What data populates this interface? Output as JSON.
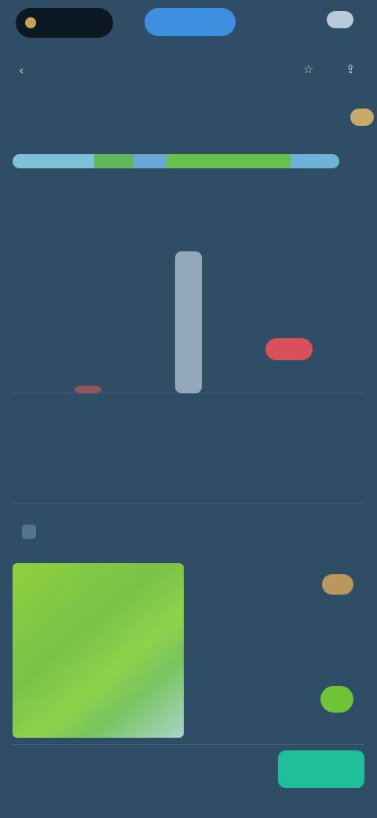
{
  "topbar": {
    "brand": "",
    "primary_action": "",
    "right_text": ""
  },
  "titlebar": {
    "back_icon": "chevron-left-icon",
    "title": "",
    "meta": "",
    "star_icon": "star-icon",
    "share_icon": "share-icon"
  },
  "tabs": [
    {
      "label": "",
      "value": ""
    },
    {
      "label": "",
      "value": ""
    },
    {
      "label": "",
      "value": ""
    },
    {
      "label": "",
      "value": ""
    },
    {
      "label": "",
      "value": "",
      "active": true
    }
  ],
  "progress": {
    "segments": [
      {
        "fraction": 0.25,
        "color": "#7fc1d9"
      },
      {
        "fraction": 0.12,
        "color": "#5fb95a"
      },
      {
        "fraction": 0.1,
        "color": "#6aa7d4"
      },
      {
        "fraction": 0.38,
        "color": "#66c24d"
      },
      {
        "fraction": 0.15,
        "color": "#6fb2d8"
      }
    ]
  },
  "section": {
    "left": "",
    "right": ""
  },
  "columns": [
    "",
    "",
    "",
    "",
    "",
    "",
    ""
  ],
  "chart_data": {
    "type": "bar",
    "categories": [
      "",
      "",
      "",
      "",
      "",
      "",
      ""
    ],
    "values": [
      0,
      0.05,
      0,
      0.95,
      0,
      0.2,
      0
    ],
    "highlight_index": 5,
    "colors": {
      "base": "#9fb3c4",
      "highlight": "#d8505a",
      "accent": "#c2554e"
    },
    "title": "",
    "xlabel": "",
    "ylabel": "",
    "ylim": [
      0,
      1
    ]
  },
  "description": "",
  "center_link": "",
  "card": {
    "title": "",
    "tile_label": "",
    "side_label": "",
    "side_value_1": "",
    "side_value_2": "",
    "side_sub": "",
    "side_note": ""
  },
  "bottom": {
    "text": "",
    "cta": ""
  },
  "colors": {
    "background": "#2f4e66",
    "primary": "#3d8fe0",
    "cta": "#1fbf9a",
    "accent_gold": "#c8a25a"
  }
}
